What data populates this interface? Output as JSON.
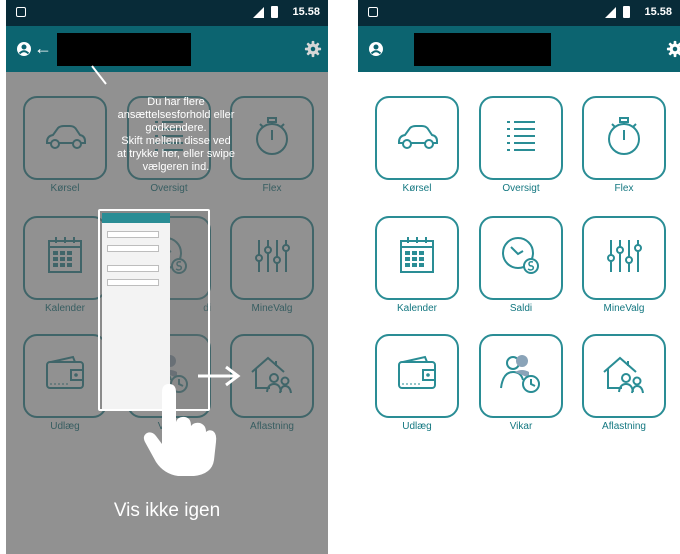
{
  "status_bar": {
    "network": "4G",
    "time": "15.58"
  },
  "tiles": [
    {
      "id": "korsel",
      "label": "Kørsel",
      "icon": "car-icon"
    },
    {
      "id": "oversigt",
      "label": "Oversigt",
      "icon": "list-icon"
    },
    {
      "id": "flex",
      "label": "Flex",
      "icon": "stopwatch-icon"
    },
    {
      "id": "kalender",
      "label": "Kalender",
      "icon": "calendar-icon"
    },
    {
      "id": "saldi",
      "label": "Saldi",
      "icon": "clock-coin-icon"
    },
    {
      "id": "minevalg",
      "label": "MineValg",
      "icon": "sliders-icon"
    },
    {
      "id": "udlaeg",
      "label": "Udlæg",
      "icon": "wallet-icon"
    },
    {
      "id": "vikar",
      "label": "Vikar",
      "icon": "substitute-person-clock-icon"
    },
    {
      "id": "aflastning",
      "label": "Aflastning",
      "icon": "house-people-icon"
    }
  ],
  "left_screen": {
    "partial_labels": [
      "di"
    ],
    "tooltip": {
      "lines": [
        "Du har flere",
        "ansættelsesforhold eller",
        "godkendere.",
        "Skift mellem disse ved",
        "at trykke her, eller swipe",
        "vælgeren ind."
      ]
    },
    "dismiss_label": "Vis ikke igen"
  },
  "colors": {
    "teal": "#0c6470",
    "status_bar": "#082b38",
    "tile_border": "#2a8d95",
    "label": "#137780"
  }
}
